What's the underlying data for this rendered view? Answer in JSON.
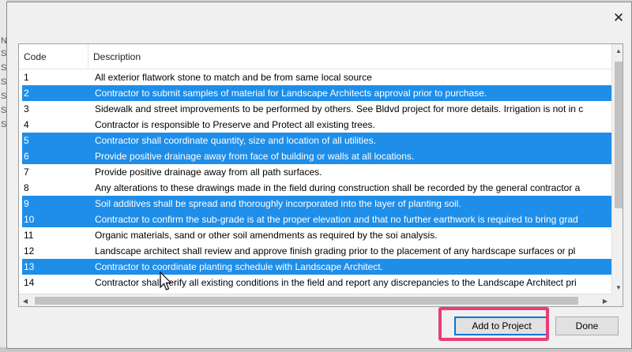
{
  "background": {
    "left_strip_chars": [
      "N",
      "S",
      "S",
      "S",
      "S",
      "S",
      "S"
    ]
  },
  "dialog": {
    "close_symbol": "✕"
  },
  "list": {
    "columns": {
      "code": "Code",
      "description": "Description"
    },
    "rows": [
      {
        "code": "1",
        "description": "All exterior flatwork stone to match and be from same local source",
        "selected": false
      },
      {
        "code": "2",
        "description": "Contractor to submit samples of material for Landscape Architects approval prior to purchase.",
        "selected": true
      },
      {
        "code": "3",
        "description": "Sidewalk and street improvements to be performed by others. See Bldvd project for more details. Irrigation is not in c",
        "selected": false
      },
      {
        "code": "4",
        "description": "Contractor is responsible to Preserve and Protect all existing trees.",
        "selected": false
      },
      {
        "code": "5",
        "description": "Contractor shall coordinate quantity, size and location of all utilities.",
        "selected": true
      },
      {
        "code": "6",
        "description": "Provide positive drainage away from face of building or walls at all locations.",
        "selected": true
      },
      {
        "code": "7",
        "description": "Provide positive drainage away from all path surfaces.",
        "selected": false
      },
      {
        "code": "8",
        "description": "Any alterations to these drawings made in the field during construction shall be recorded by the general contractor a",
        "selected": false
      },
      {
        "code": "9",
        "description": "Soil additives shall be spread and thoroughly incorporated into the layer of planting soil.",
        "selected": true
      },
      {
        "code": "10",
        "description": "Contractor to confirm the sub-grade is at the proper elevation and that no further earthwork is required to bring grad",
        "selected": true
      },
      {
        "code": "11",
        "description": "Organic materials, sand or other soil amendments as required by the soi analysis.",
        "selected": false
      },
      {
        "code": "12",
        "description": "Landscape architect shall review and approve finish grading prior to the placement of any hardscape surfaces or pl",
        "selected": false
      },
      {
        "code": "13",
        "description": "Contractor to coordinate planting schedule with Landscape Architect.",
        "selected": true
      },
      {
        "code": "14",
        "description": "Contractor shall verify all existing conditions in the field and report any discrepancies to the Landscape Architect pri",
        "selected": false
      }
    ]
  },
  "scrollbar": {
    "up": "▲",
    "down": "▼",
    "left": "◀",
    "right": "▶"
  },
  "buttons": {
    "add_to_project": "Add to Project",
    "done": "Done"
  },
  "colors": {
    "selection": "#1e8ee9",
    "highlight_box": "#ea3d77",
    "default_button_border": "#0078d7"
  }
}
